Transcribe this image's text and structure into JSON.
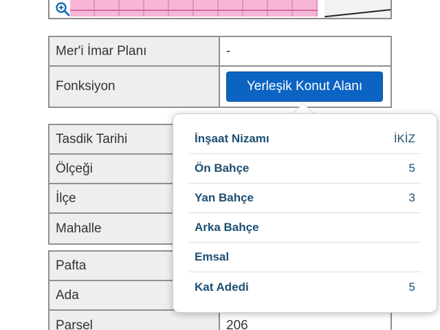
{
  "map": {
    "zoom_icon": "zoom-in-icon"
  },
  "plan_table": {
    "rows": [
      {
        "label": "Mer'i İmar Planı",
        "value": "-"
      },
      {
        "label": "Fonksiyon",
        "button": "Yerleşik Konut Alanı"
      }
    ]
  },
  "detail_table": {
    "rows": [
      {
        "label": "Tasdik Tarihi"
      },
      {
        "label": "Ölçeği"
      },
      {
        "label": "İlçe"
      },
      {
        "label": "Mahalle"
      }
    ]
  },
  "parcel_table": {
    "rows": [
      {
        "label": "Pafta",
        "value": ""
      },
      {
        "label": "Ada",
        "value": ""
      },
      {
        "label": "Parsel",
        "value": "206"
      }
    ]
  },
  "popover": {
    "items": [
      {
        "label": "İnşaat Nizamı",
        "value": "İKİZ"
      },
      {
        "label": "Ön Bahçe",
        "value": "5"
      },
      {
        "label": "Yan Bahçe",
        "value": "3"
      },
      {
        "label": "Arka Bahçe",
        "value": ""
      },
      {
        "label": "Emsal",
        "value": ""
      },
      {
        "label": "Kat Adedi",
        "value": "5"
      }
    ]
  },
  "colors": {
    "button": "#0b63c2",
    "label_cell": "#eeeeee",
    "popover_text": "#1c4f73"
  }
}
